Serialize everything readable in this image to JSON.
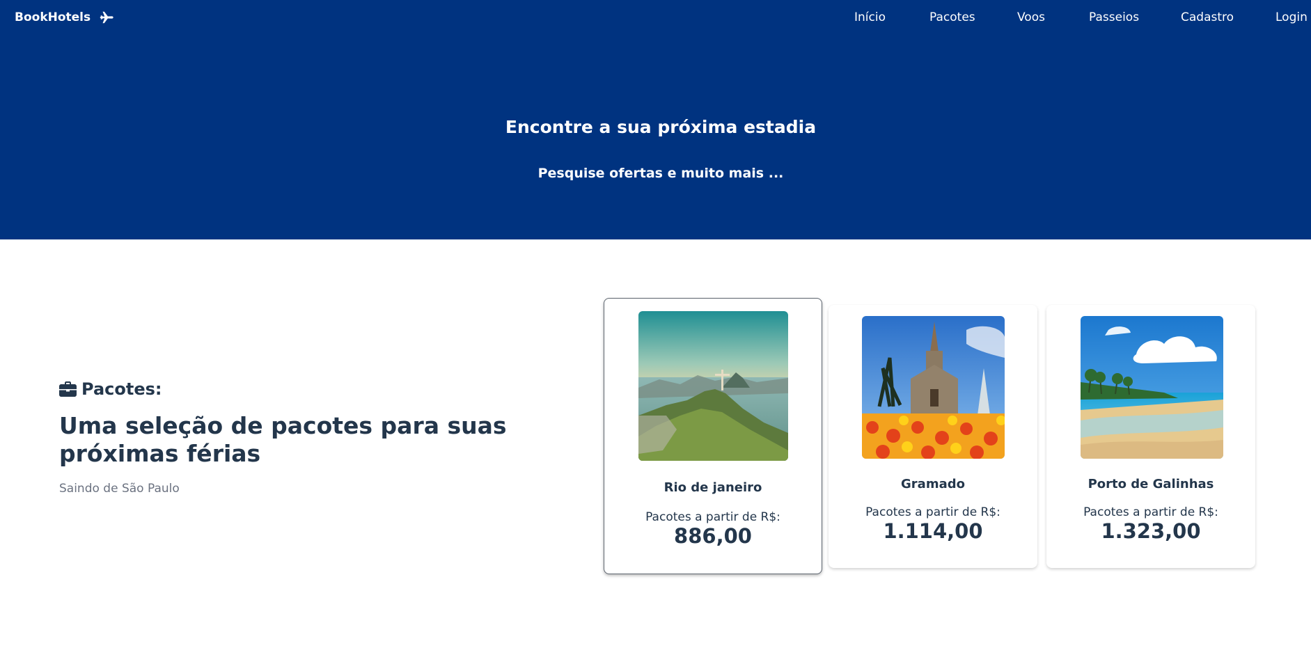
{
  "brand": {
    "name": "BookHotels",
    "icon": "plane-icon"
  },
  "nav": [
    "Início",
    "Pacotes",
    "Voos",
    "Passeios",
    "Cadastro",
    "Login"
  ],
  "hero": {
    "title": "Encontre a sua próxima estadia",
    "subtitle": "Pesquise ofertas e muito mais ..."
  },
  "packages": {
    "heading": "Pacotes:",
    "heading_icon": "briefcase-icon",
    "title": "Uma seleção de pacotes para suas próximas férias",
    "origin": "Saindo de São Paulo"
  },
  "cards": [
    {
      "city": "Rio de janeiro",
      "label": "Pacotes a partir de R$:",
      "price": "886,00"
    },
    {
      "city": "Gramado",
      "label": "Pacotes a partir de R$:",
      "price": "1.114,00"
    },
    {
      "city": "Porto de Galinhas",
      "label": "Pacotes a partir de R$:",
      "price": "1.323,00"
    }
  ],
  "colors": {
    "primary": "#003380",
    "text": "#23364b",
    "muted": "#6b7280"
  }
}
